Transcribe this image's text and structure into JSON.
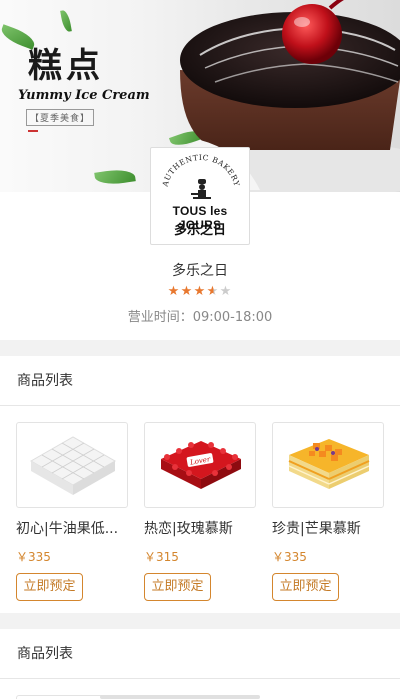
{
  "banner": {
    "title": "糕点",
    "subtitle": "Yummy Ice Cream",
    "tag": "夏季美食"
  },
  "logo": {
    "arc_text": "AUTHENTIC BAKERY",
    "brand": "TOUS les JOURS",
    "brand_cn": "多乐之日"
  },
  "store": {
    "name": "多乐之日",
    "rating": 3.5,
    "rating_max": 5,
    "hours": "营业时间：09:00-18:00"
  },
  "sections": [
    {
      "title": "商品列表",
      "products": [
        {
          "name": "初心|牛油果低...",
          "price": "￥335",
          "button": "立即预定",
          "image": "white-hexagon-cake"
        },
        {
          "name": "热恋|玫瑰慕斯",
          "price": "￥315",
          "button": "立即预定",
          "image": "red-rose-cake"
        },
        {
          "name": "珍贵|芒果慕斯",
          "price": "￥335",
          "button": "立即预定",
          "image": "mango-layer-cake"
        }
      ]
    },
    {
      "title": "商品列表"
    }
  ],
  "colors": {
    "accent": "#d4862e",
    "star_on": "#e8782f",
    "star_off": "#cccccc",
    "divider_bg": "#f2f2f2"
  }
}
